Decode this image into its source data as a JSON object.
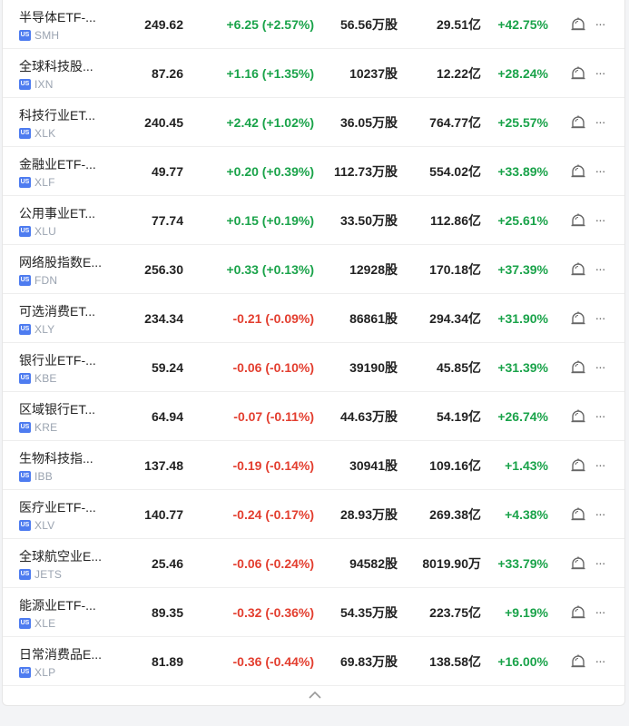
{
  "rows": [
    {
      "name": "半导体ETF-...",
      "market": "US",
      "ticker": "SMH",
      "price": "249.62",
      "change": "+6.25 (+2.57%)",
      "dir": "up",
      "volume": "56.56万股",
      "cap": "29.51亿",
      "ytd": "+42.75%",
      "ytd_dir": "up"
    },
    {
      "name": "全球科技股...",
      "market": "US",
      "ticker": "IXN",
      "price": "87.26",
      "change": "+1.16 (+1.35%)",
      "dir": "up",
      "volume": "10237股",
      "cap": "12.22亿",
      "ytd": "+28.24%",
      "ytd_dir": "up"
    },
    {
      "name": "科技行业ET...",
      "market": "US",
      "ticker": "XLK",
      "price": "240.45",
      "change": "+2.42 (+1.02%)",
      "dir": "up",
      "volume": "36.05万股",
      "cap": "764.77亿",
      "ytd": "+25.57%",
      "ytd_dir": "up"
    },
    {
      "name": "金融业ETF-...",
      "market": "US",
      "ticker": "XLF",
      "price": "49.77",
      "change": "+0.20 (+0.39%)",
      "dir": "up",
      "volume": "112.73万股",
      "cap": "554.02亿",
      "ytd": "+33.89%",
      "ytd_dir": "up"
    },
    {
      "name": "公用事业ET...",
      "market": "US",
      "ticker": "XLU",
      "price": "77.74",
      "change": "+0.15 (+0.19%)",
      "dir": "up",
      "volume": "33.50万股",
      "cap": "112.86亿",
      "ytd": "+25.61%",
      "ytd_dir": "up"
    },
    {
      "name": "网络股指数E...",
      "market": "US",
      "ticker": "FDN",
      "price": "256.30",
      "change": "+0.33 (+0.13%)",
      "dir": "up",
      "volume": "12928股",
      "cap": "170.18亿",
      "ytd": "+37.39%",
      "ytd_dir": "up"
    },
    {
      "name": "可选消费ET...",
      "market": "US",
      "ticker": "XLY",
      "price": "234.34",
      "change": "-0.21 (-0.09%)",
      "dir": "down",
      "volume": "86861股",
      "cap": "294.34亿",
      "ytd": "+31.90%",
      "ytd_dir": "up"
    },
    {
      "name": "银行业ETF-...",
      "market": "US",
      "ticker": "KBE",
      "price": "59.24",
      "change": "-0.06 (-0.10%)",
      "dir": "down",
      "volume": "39190股",
      "cap": "45.85亿",
      "ytd": "+31.39%",
      "ytd_dir": "up"
    },
    {
      "name": "区域银行ET...",
      "market": "US",
      "ticker": "KRE",
      "price": "64.94",
      "change": "-0.07 (-0.11%)",
      "dir": "down",
      "volume": "44.63万股",
      "cap": "54.19亿",
      "ytd": "+26.74%",
      "ytd_dir": "up"
    },
    {
      "name": "生物科技指...",
      "market": "US",
      "ticker": "IBB",
      "price": "137.48",
      "change": "-0.19 (-0.14%)",
      "dir": "down",
      "volume": "30941股",
      "cap": "109.16亿",
      "ytd": "+1.43%",
      "ytd_dir": "up"
    },
    {
      "name": "医疗业ETF-...",
      "market": "US",
      "ticker": "XLV",
      "price": "140.77",
      "change": "-0.24 (-0.17%)",
      "dir": "down",
      "volume": "28.93万股",
      "cap": "269.38亿",
      "ytd": "+4.38%",
      "ytd_dir": "up"
    },
    {
      "name": "全球航空业E...",
      "market": "US",
      "ticker": "JETS",
      "price": "25.46",
      "change": "-0.06 (-0.24%)",
      "dir": "down",
      "volume": "94582股",
      "cap": "8019.90万",
      "ytd": "+33.79%",
      "ytd_dir": "up"
    },
    {
      "name": "能源业ETF-...",
      "market": "US",
      "ticker": "XLE",
      "price": "89.35",
      "change": "-0.32 (-0.36%)",
      "dir": "down",
      "volume": "54.35万股",
      "cap": "223.75亿",
      "ytd": "+9.19%",
      "ytd_dir": "up"
    },
    {
      "name": "日常消费品E...",
      "market": "US",
      "ticker": "XLP",
      "price": "81.89",
      "change": "-0.36 (-0.44%)",
      "dir": "down",
      "volume": "69.83万股",
      "cap": "138.58亿",
      "ytd": "+16.00%",
      "ytd_dir": "up"
    }
  ],
  "row_actions": {
    "alert_icon": "bell-icon",
    "more_label": "···"
  },
  "footer": {
    "collapse_icon": "chevron-up-icon"
  },
  "colors": {
    "up": "#1aa34a",
    "down": "#e33e2f",
    "badge": "#4e7cf0",
    "ticker": "#9aa3b0"
  }
}
